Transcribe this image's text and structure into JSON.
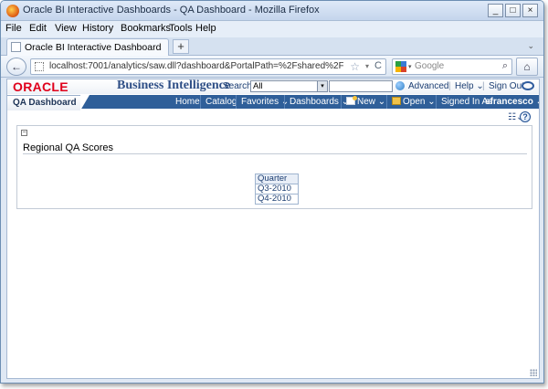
{
  "window": {
    "title": "Oracle BI Interactive Dashboards - QA Dashboard - Mozilla Firefox",
    "minimize": "_",
    "maximize": "□",
    "close": "×"
  },
  "menubar": [
    "File",
    "Edit",
    "View",
    "History",
    "Bookmarks",
    "Tools",
    "Help"
  ],
  "tab": {
    "label": "Oracle BI Interactive Dashboards - QA Dash...",
    "new_tab": "+",
    "list": "⌄"
  },
  "navbar": {
    "url": "localhost:7001/analytics/saw.dll?dashboard&PortalPath=%2Fshared%2FQA Reports%2F_por",
    "search_placeholder": "Google",
    "star": "☆",
    "drop": "▾",
    "reload": "C",
    "back": "←",
    "home": "⌂",
    "search_glyph": "⌕",
    "search_drop": "▾"
  },
  "obi_header": {
    "logo": "ORACLE",
    "product": "Business Intelligence",
    "search_label": "Search",
    "search_scope": "All",
    "advanced": "Advanced",
    "help": "Help ⌄",
    "sign_out": "Sign Out",
    "select_arrow": "▾"
  },
  "obi_nav": {
    "dashboard_tab": "QA Dashboard",
    "home": "Home",
    "catalog": "Catalog",
    "favorites": "Favorites ⌄",
    "dashboards": "Dashboards ⌄",
    "new": "New ⌄",
    "open": "Open ⌄",
    "signed_in_as": "Signed In As",
    "user": "sfrancesco ⌄"
  },
  "toolbar": {
    "options": "☷⌄",
    "help": "?"
  },
  "section": {
    "collapse": "−",
    "title": "Regional QA Scores",
    "table": {
      "header": "Quarter",
      "rows": [
        "Q3-2010",
        "Q4-2010"
      ]
    }
  }
}
